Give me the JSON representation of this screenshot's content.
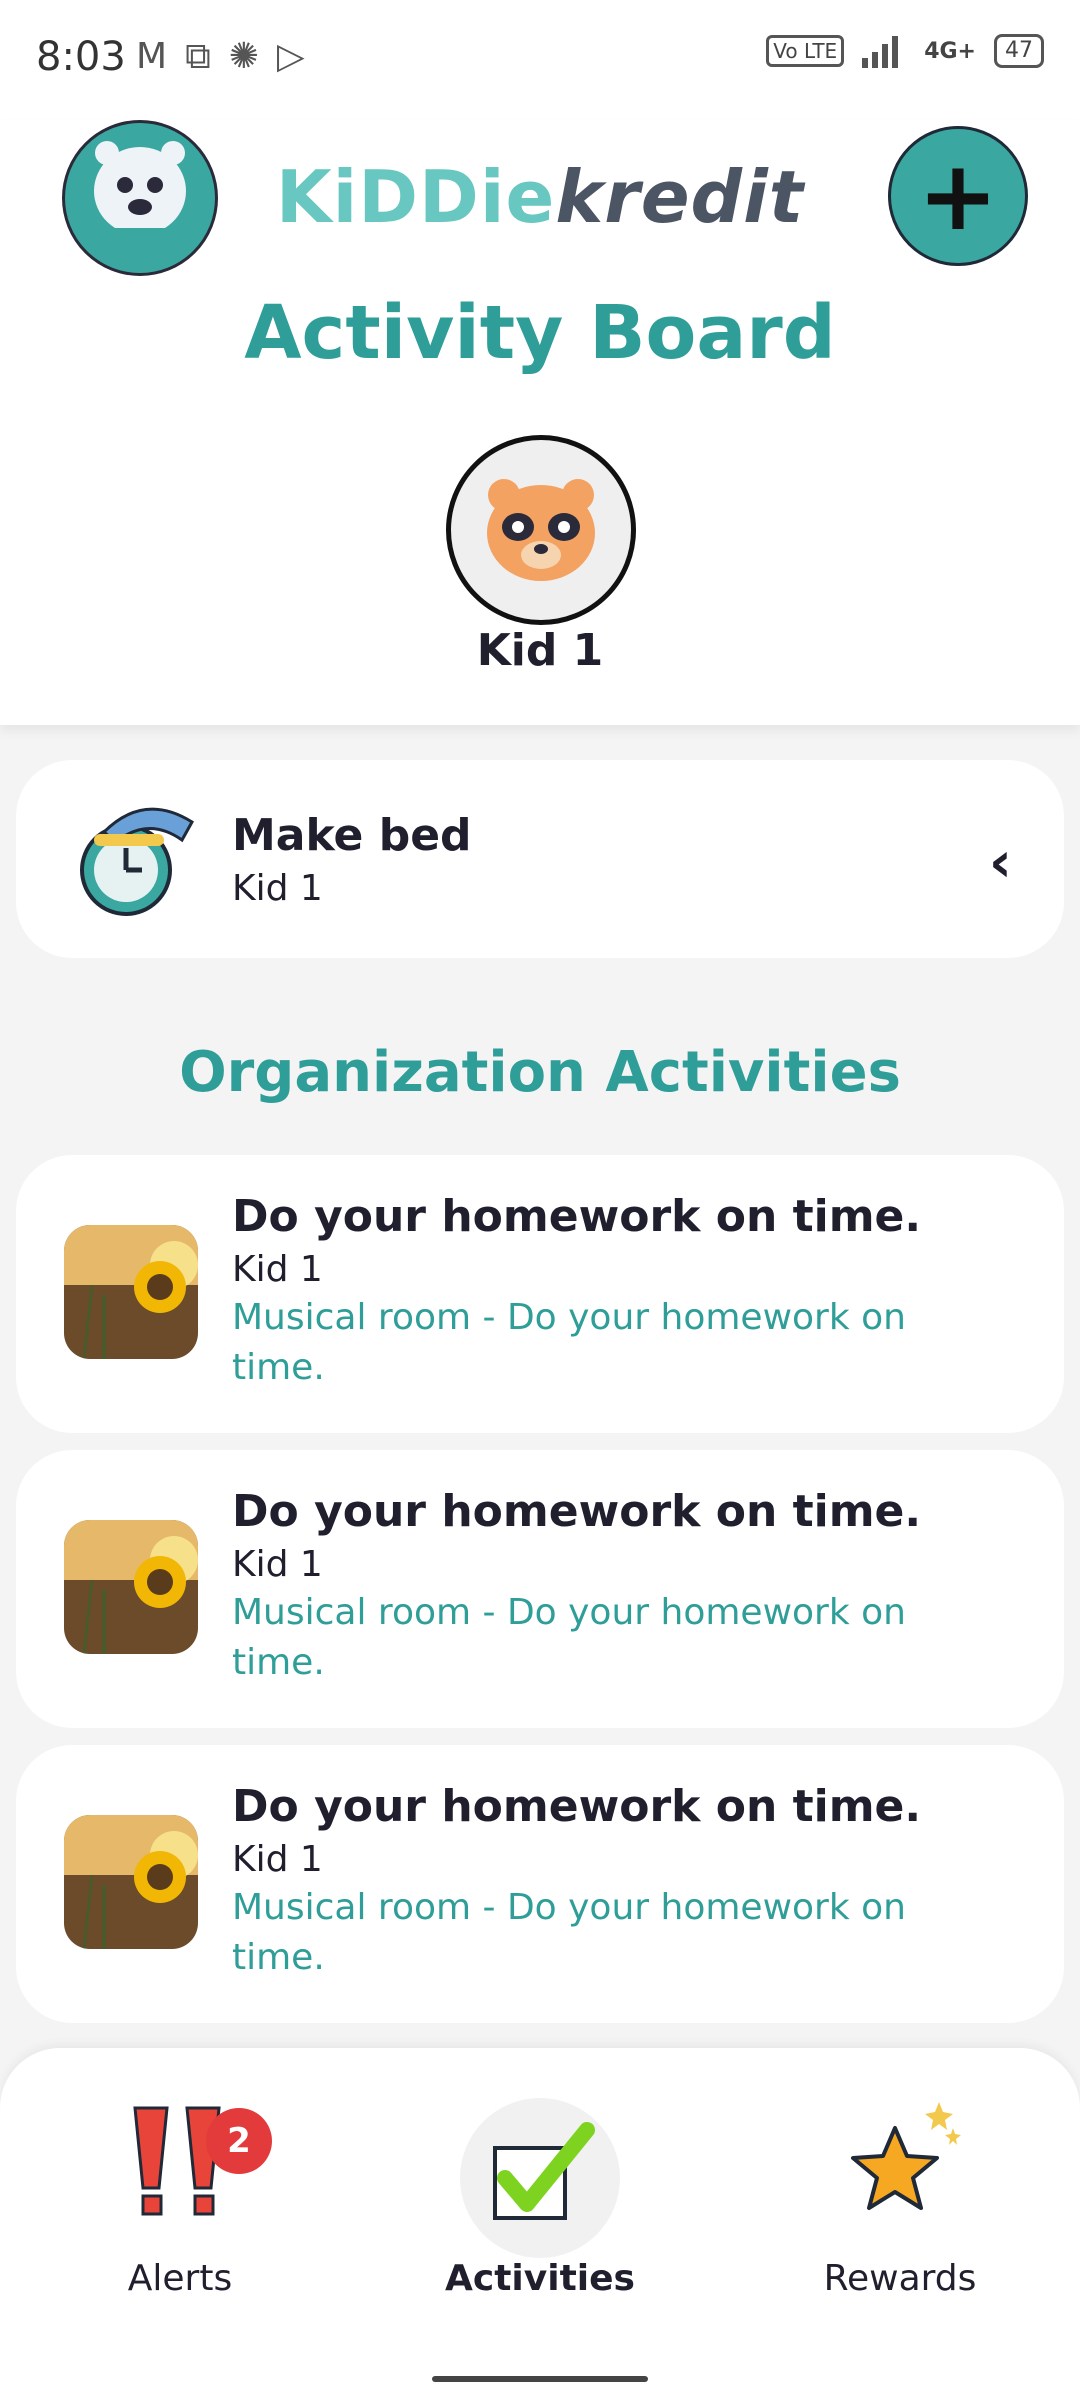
{
  "status": {
    "time": "8:03",
    "left_icons": [
      "gmail-icon",
      "translate-icon",
      "sync-icon",
      "play-store-icon"
    ],
    "volte": "Vo LTE",
    "network": "4G+",
    "battery": "47"
  },
  "header": {
    "brand_part1": "KiDDie",
    "brand_part2": "kredit",
    "title": "Activity Board",
    "kid_name": "Kid 1"
  },
  "current_activity": {
    "title": "Make bed",
    "kid": "Kid 1",
    "chevron": "‹"
  },
  "section": {
    "title": "Organization Activities"
  },
  "activities": [
    {
      "title": "Do your homework on time.",
      "kid": "Kid 1",
      "desc": "Musical room - Do your homework on time."
    },
    {
      "title": "Do your homework on time.",
      "kid": "Kid 1",
      "desc": "Musical room - Do your homework on time."
    },
    {
      "title": "Do your homework on time.",
      "kid": "Kid 1",
      "desc": "Musical room - Do your homework on time."
    }
  ],
  "bottom_nav": {
    "alerts_label": "Alerts",
    "alerts_badge": "2",
    "activities_label": "Activities",
    "rewards_label": "Rewards"
  },
  "colors": {
    "accent": "#2f9e98",
    "brand_light": "#68c7c0",
    "badge": "#e33b3b"
  }
}
